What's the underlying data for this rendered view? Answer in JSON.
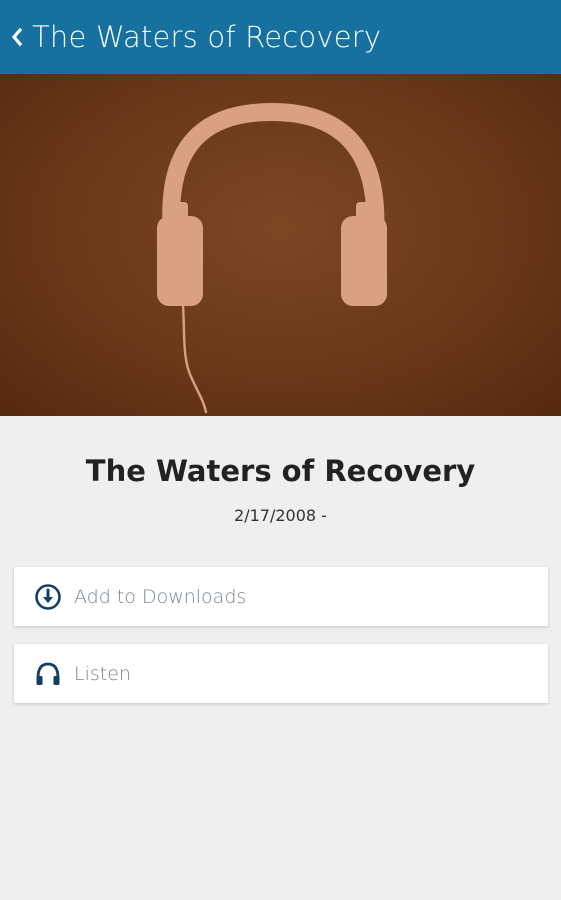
{
  "header": {
    "title": "The Waters of Recovery",
    "back_icon": "chevron-left-icon",
    "color": "#1670a0"
  },
  "hero": {
    "image": "headphones-artwork",
    "background_color": "#6a3918",
    "artwork_color": "#d9a082"
  },
  "content": {
    "title": "The Waters of Recovery",
    "date": "2/17/2008 -"
  },
  "actions": [
    {
      "label": "Add to Downloads",
      "icon": "download-circle-icon"
    },
    {
      "label": "Listen",
      "icon": "headphones-icon"
    }
  ],
  "colors": {
    "icon_accent": "#123e63",
    "page_background": "#efefef"
  }
}
